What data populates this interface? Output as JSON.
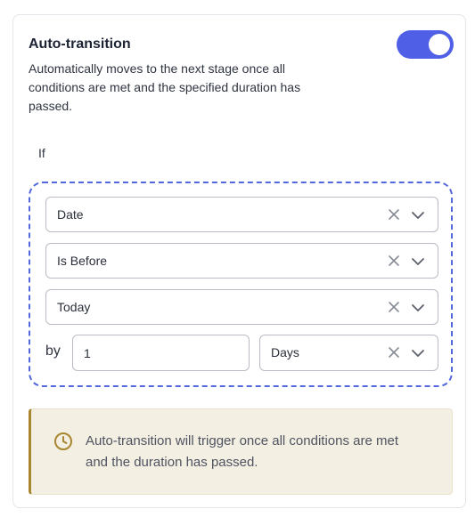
{
  "header": {
    "title": "Auto-transition",
    "description": "Automatically moves to the next stage once all conditions are met and the specified duration has passed.",
    "toggle_on": true
  },
  "condition": {
    "if_label": "If",
    "field": {
      "value": "Date"
    },
    "operator": {
      "value": "Is Before"
    },
    "target": {
      "value": "Today"
    },
    "by_label": "by",
    "amount": "1",
    "unit": {
      "value": "Days"
    }
  },
  "notice": {
    "icon": "clock-icon",
    "message": "Auto-transition will trigger once all conditions are met and the duration has passed."
  },
  "colors": {
    "accent": "#4f5fe6",
    "dashed_border": "#5468dd",
    "notice_bg": "#f3efe3",
    "notice_accent": "#a7862f"
  }
}
